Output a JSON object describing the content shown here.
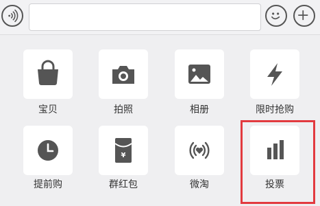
{
  "input_bar": {
    "voice_icon": "voice-icon",
    "text_value": "",
    "emoji_icon": "emoji-icon",
    "plus_icon": "plus-icon"
  },
  "grid": {
    "items": [
      {
        "label": "宝贝",
        "icon": "shopping-bag-icon"
      },
      {
        "label": "拍照",
        "icon": "camera-icon"
      },
      {
        "label": "相册",
        "icon": "photo-album-icon"
      },
      {
        "label": "限时抢购",
        "icon": "lightning-icon"
      },
      {
        "label": "提前购",
        "icon": "clock-icon"
      },
      {
        "label": "群红包",
        "icon": "red-envelope-icon"
      },
      {
        "label": "微淘",
        "icon": "broadcast-heart-icon"
      },
      {
        "label": "投票",
        "icon": "bar-chart-icon"
      }
    ]
  },
  "colors": {
    "icon_gray": "#555555",
    "highlight": "#e23a3f",
    "background": "#efeff1"
  }
}
